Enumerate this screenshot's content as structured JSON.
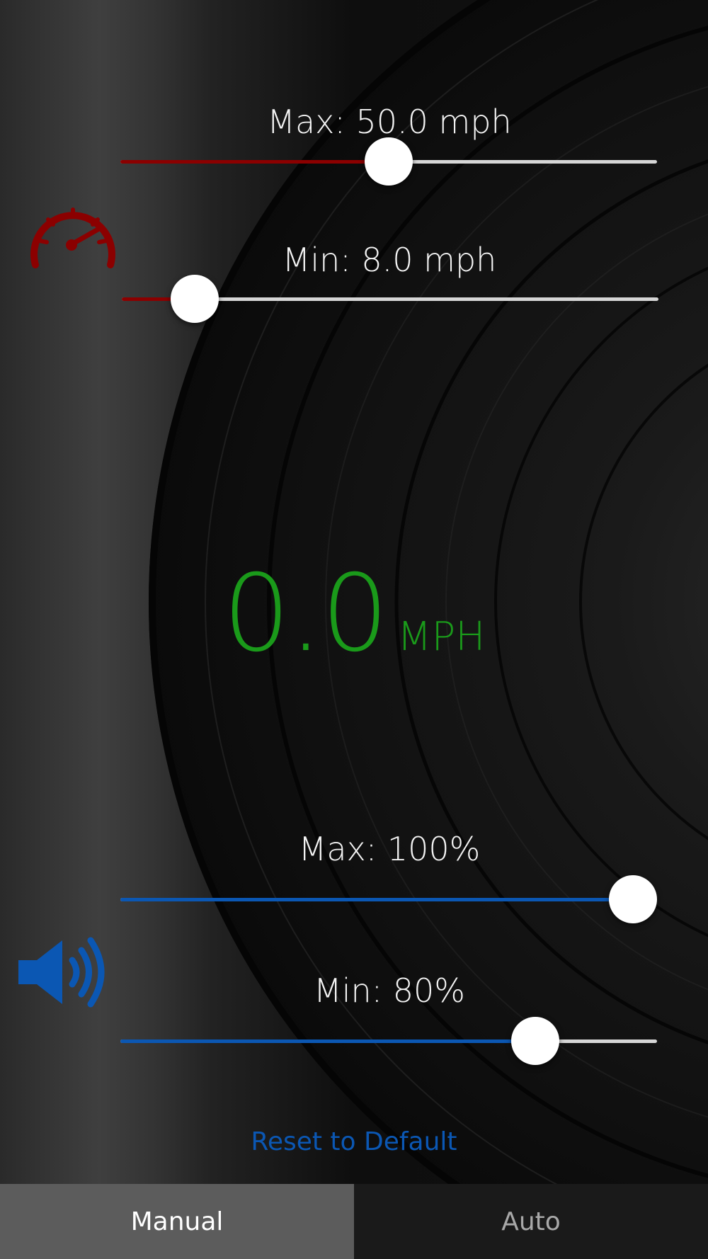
{
  "colors": {
    "speed_accent": "#8b0000",
    "volume_accent": "#0b57b3",
    "speed_readout": "#1a9a1a",
    "track_inactive": "#d6d6d6",
    "tab_selected_bg": "#5c5c5c",
    "tab_unselected_bg": "#1a1a1a"
  },
  "speed_section": {
    "icon": "speedometer-icon",
    "max_label": "Max: 50.0 mph",
    "max_fraction": 0.5,
    "min_label": "Min: 8.0 mph",
    "min_fraction": 0.1
  },
  "readout": {
    "value": "0.0",
    "unit": "MPH"
  },
  "volume_section": {
    "icon": "speaker-icon",
    "max_label": "Max: 100%",
    "max_fraction": 1.0,
    "min_label": "Min: 80%",
    "min_fraction": 0.8
  },
  "reset_label": "Reset to Default",
  "tabs": [
    {
      "label": "Manual",
      "selected": true
    },
    {
      "label": "Auto",
      "selected": false
    }
  ]
}
